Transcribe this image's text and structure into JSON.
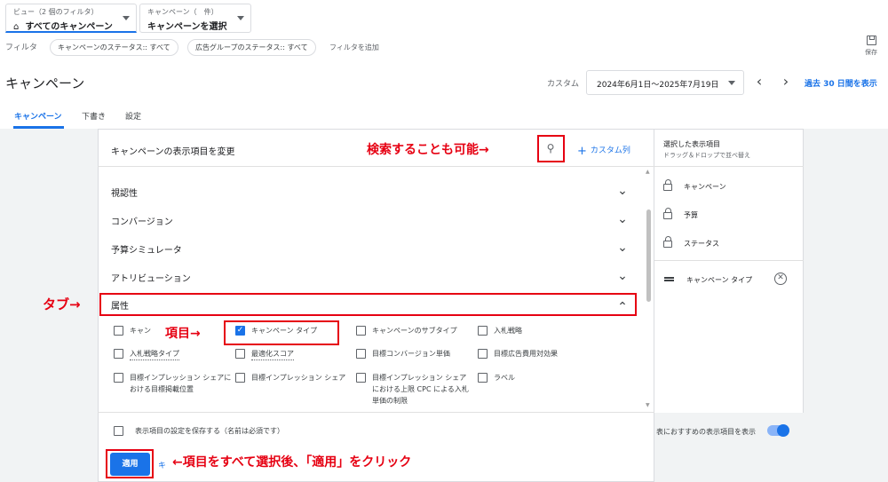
{
  "view_select": {
    "small": "ビュー（2 個のフィルタ）",
    "value": "すべてのキャンペーン"
  },
  "campaign_select": {
    "small": "キャンペーン（　件）",
    "value": "キャンペーンを選択"
  },
  "filter_bar": {
    "label": "フィルタ",
    "chips": [
      "キャンペーンのステータス:: すべて",
      "広告グループのステータス:: すべて"
    ],
    "add": "フィルタを追加"
  },
  "save": {
    "label": "保存"
  },
  "page_title": "キャンペーン",
  "date": {
    "custom_label": "カスタム",
    "range": "2024年6月1日～2025年7月19日",
    "last30": "過去 30 日間を表示"
  },
  "tabs": [
    {
      "label": "キャンペーン"
    },
    {
      "label": "下書き"
    },
    {
      "label": "設定"
    }
  ],
  "panel": {
    "title": "キャンペーンの表示項目を変更",
    "custom_column": "カスタム列",
    "categories": [
      "視認性",
      "コンバージョン",
      "予算シミュレータ",
      "アトリビューション",
      "属性"
    ],
    "options": [
      {
        "label": "キャン",
        "checked": false
      },
      {
        "label": "キャンペーン タイプ",
        "checked": true
      },
      {
        "label": "キャンペーンのサブタイプ",
        "checked": false
      },
      {
        "label": "入札戦略",
        "checked": false
      },
      {
        "label": "入札戦略タイプ",
        "checked": false
      },
      {
        "label": "最適化スコア",
        "checked": false
      },
      {
        "label": "目標コンバージョン単価",
        "checked": false
      },
      {
        "label": "目標広告費用対効果",
        "checked": false
      },
      {
        "label": "目標インプレッション シェアにおける目標掲載位置",
        "checked": false
      },
      {
        "label": "目標インプレッション シェア",
        "checked": false
      },
      {
        "label": "目標インプレッション シェアにおける上限 CPC による入札単価の制限",
        "checked": false
      },
      {
        "label": "ラベル",
        "checked": false
      }
    ],
    "save_settings": "表示項目の設定を保存する（名前は必須です）",
    "recommended": "表におすすめの表示項目を表示",
    "apply": "適用",
    "cancel": "キ"
  },
  "side": {
    "title": "選択した表示項目",
    "subtitle": "ドラッグ＆ドロップで並べ替え",
    "locked": [
      "キャンペーン",
      "予算",
      "ステータス"
    ],
    "selected": [
      "キャンペーン タイプ"
    ]
  },
  "annotations": {
    "search": "検索することも可能→",
    "tab": "タブ→",
    "item": "項目→",
    "apply": "←項目をすべて選択後、「適用」をクリック"
  }
}
